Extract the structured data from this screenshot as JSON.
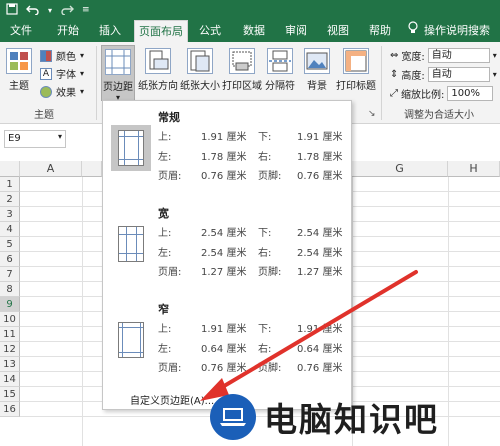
{
  "tabs": [
    "文件",
    "开始",
    "插入",
    "页面布局",
    "公式",
    "数据",
    "审阅",
    "视图",
    "帮助"
  ],
  "active_tab": "页面布局",
  "tell_me": "操作说明搜索",
  "ribbon": {
    "theme_group": {
      "theme_label": "主题",
      "colors": "颜色",
      "fonts": "字体",
      "effects": "效果",
      "group_label": "主题"
    },
    "margins": "页边距",
    "orientation": "纸张方向",
    "size": "纸张大小",
    "print_area": "打印区域",
    "breaks": "分隔符",
    "background": "背景",
    "print_titles": "打印标题",
    "scale_group": {
      "width_label": "宽度:",
      "width_value": "自动",
      "height_label": "高度:",
      "height_value": "自动",
      "scale_label": "缩放比例:",
      "scale_value": "100%",
      "group_label": "调整为合适大小"
    }
  },
  "formula_bar": {
    "name_box": "E9"
  },
  "grid": {
    "columns": [
      "A",
      "G",
      "H"
    ],
    "rows": [
      "1",
      "2",
      "3",
      "4",
      "5",
      "6",
      "7",
      "8",
      "9",
      "10",
      "11",
      "12",
      "13",
      "14",
      "15",
      "16"
    ],
    "selected_row": "9"
  },
  "margins_menu": {
    "options": [
      {
        "name": "常规",
        "top_label": "上:",
        "top": "1.91 厘米",
        "bottom_label": "下:",
        "bottom": "1.91 厘米",
        "left_label": "左:",
        "left": "1.78 厘米",
        "right_label": "右:",
        "right": "1.78 厘米",
        "header_label": "页眉:",
        "header": "0.76 厘米",
        "footer_label": "页脚:",
        "footer": "0.76 厘米"
      },
      {
        "name": "宽",
        "top_label": "上:",
        "top": "2.54 厘米",
        "bottom_label": "下:",
        "bottom": "2.54 厘米",
        "left_label": "左:",
        "left": "2.54 厘米",
        "right_label": "右:",
        "right": "2.54 厘米",
        "header_label": "页眉:",
        "header": "1.27 厘米",
        "footer_label": "页脚:",
        "footer": "1.27 厘米"
      },
      {
        "name": "窄",
        "top_label": "上:",
        "top": "1.91 厘米",
        "bottom_label": "下:",
        "bottom": "1.91 厘米",
        "left_label": "左:",
        "left": "0.64 厘米",
        "right_label": "右:",
        "right": "0.64 厘米",
        "header_label": "页眉:",
        "header": "0.76 厘米",
        "footer_label": "页脚:",
        "footer": "0.76 厘米"
      }
    ],
    "custom": "自定义页边距(A)..."
  },
  "watermark": {
    "text": "电脑知识吧"
  },
  "colors": {
    "excel_green": "#217346",
    "arrow_red": "#e0322b",
    "logo_blue": "#1b5fb8"
  }
}
